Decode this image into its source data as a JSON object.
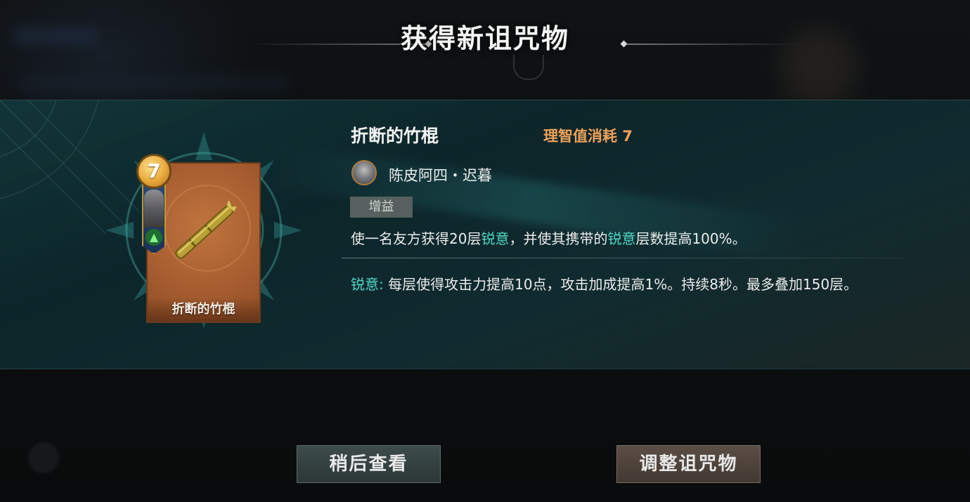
{
  "header": {
    "title": "获得新诅咒物"
  },
  "card": {
    "level": "7",
    "name": "折断的竹棍"
  },
  "item": {
    "title": "折断的竹棍",
    "sanity_cost": "理智值消耗 7",
    "owner": "陈皮阿四・迟暮",
    "tag": "增益",
    "effect_parts": {
      "p1": "使一名友方获得20层",
      "k1": "锐意",
      "p2": "，并使其携带的",
      "k2": "锐意",
      "p3": "层数提高100%。"
    },
    "note_parts": {
      "keyword": "锐意:",
      "text": " 每层使得攻击力提高10点，攻击加成提高1%。持续8秒。最多叠加150层。"
    }
  },
  "buttons": {
    "later": "稍后查看",
    "adjust": "调整诅咒物"
  },
  "colors": {
    "keyword": "#4fd9c6",
    "sanity": "#f0a25a",
    "card": "#a85e30"
  }
}
